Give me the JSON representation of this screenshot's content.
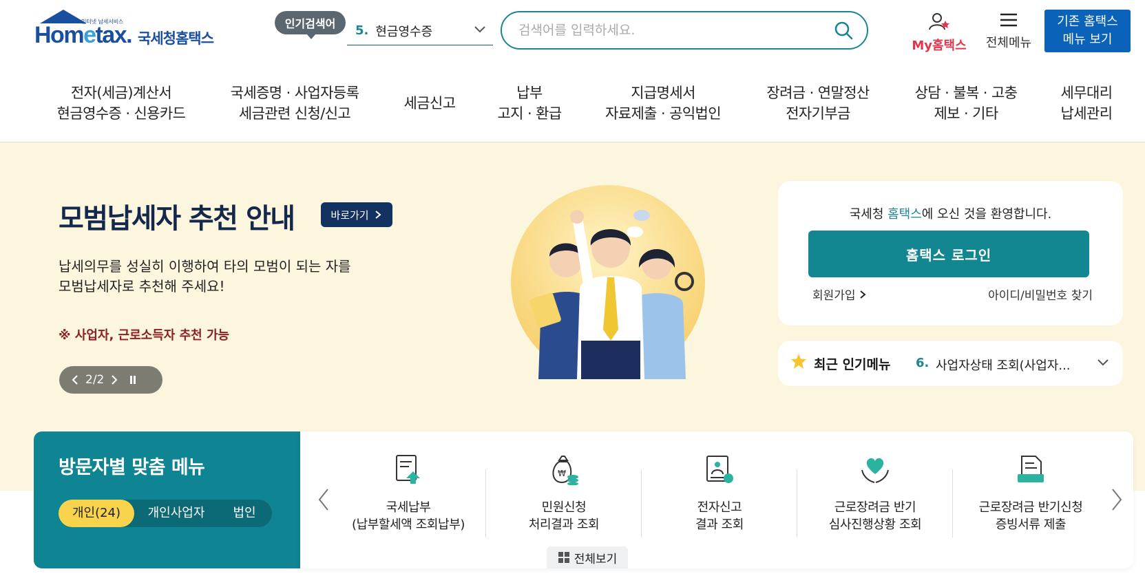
{
  "header": {
    "logo_tagline": "인터넷 납세서비스",
    "logo_home": "Hom",
    "logo_e": "e",
    "logo_tax": "tax.",
    "logo_korean": "국세청홈택스",
    "popular_badge": "인기검색어",
    "popular_rank": "5.",
    "popular_term": "현금영수증",
    "search_placeholder": "검색어를 입력하세요.",
    "my_hometax": "My홈택스",
    "all_menu": "전체메뉴",
    "legacy_line1": "기존 홈택스",
    "legacy_line2": "메뉴 보기"
  },
  "gnb": [
    {
      "line1": "전자(세금)계산서",
      "line2": "현금영수증 · 신용카드"
    },
    {
      "line1": "국세증명 · 사업자등록",
      "line2": "세금관련 신청/신고"
    },
    {
      "line1": "세금신고",
      "line2": ""
    },
    {
      "line1": "납부",
      "line2": "고지 · 환급"
    },
    {
      "line1": "지급명세서",
      "line2": "자료제출 · 공익법인"
    },
    {
      "line1": "장려금 · 연말정산",
      "line2": "전자기부금"
    },
    {
      "line1": "상담 · 불복 · 고충",
      "line2": "제보 · 기타"
    },
    {
      "line1": "세무대리",
      "line2": "납세관리"
    }
  ],
  "hero": {
    "title": "모범납세자 추천 안내",
    "link_label": "바로가기",
    "desc_line1": "납세의무를 성실히 이행하여 타의 모범이 되는 자를",
    "desc_line2": "모범납세자로 추천해 주세요!",
    "note": "※ 사업자, 근로소득자 추천 가능",
    "pager": "2/2"
  },
  "login": {
    "welcome_prefix": "국세청 ",
    "welcome_highlight": "홈택스",
    "welcome_suffix": "에 오신 것을 환영합니다.",
    "login_button": "홈택스 로그인",
    "signup": "회원가입",
    "find_account": "아이디/비밀번호 찾기"
  },
  "recent_menu": {
    "title": "최근 인기메뉴",
    "rank": "6.",
    "value": "사업자상태 조회(사업자..."
  },
  "visitor_menu": {
    "title": "방문자별 맞춤 메뉴",
    "tabs": [
      {
        "label": "개인(24)",
        "active": true
      },
      {
        "label": "개인사업자",
        "active": false
      },
      {
        "label": "법인",
        "active": false
      }
    ],
    "items": [
      {
        "line1": "국세납부",
        "line2": "(납부할세액 조회납부)",
        "icon": "tax-payment-icon"
      },
      {
        "line1": "민원신청",
        "line2": "처리결과 조회",
        "icon": "money-bag-icon"
      },
      {
        "line1": "전자신고",
        "line2": "결과 조회",
        "icon": "certificate-icon"
      },
      {
        "line1": "근로장려금 반기",
        "line2": "심사진행상황 조회",
        "icon": "heart-hands-icon"
      },
      {
        "line1": "근로장려금 반기신청",
        "line2": "증빙서류 제출",
        "icon": "document-folder-icon"
      }
    ],
    "view_all": "전체보기"
  },
  "colors": {
    "brand_teal": "#138791",
    "brand_blue": "#0b63b9",
    "hero_bg": "#fdf6de",
    "visitor_bg": "#0f8492",
    "active_tab": "#f7d44c"
  }
}
